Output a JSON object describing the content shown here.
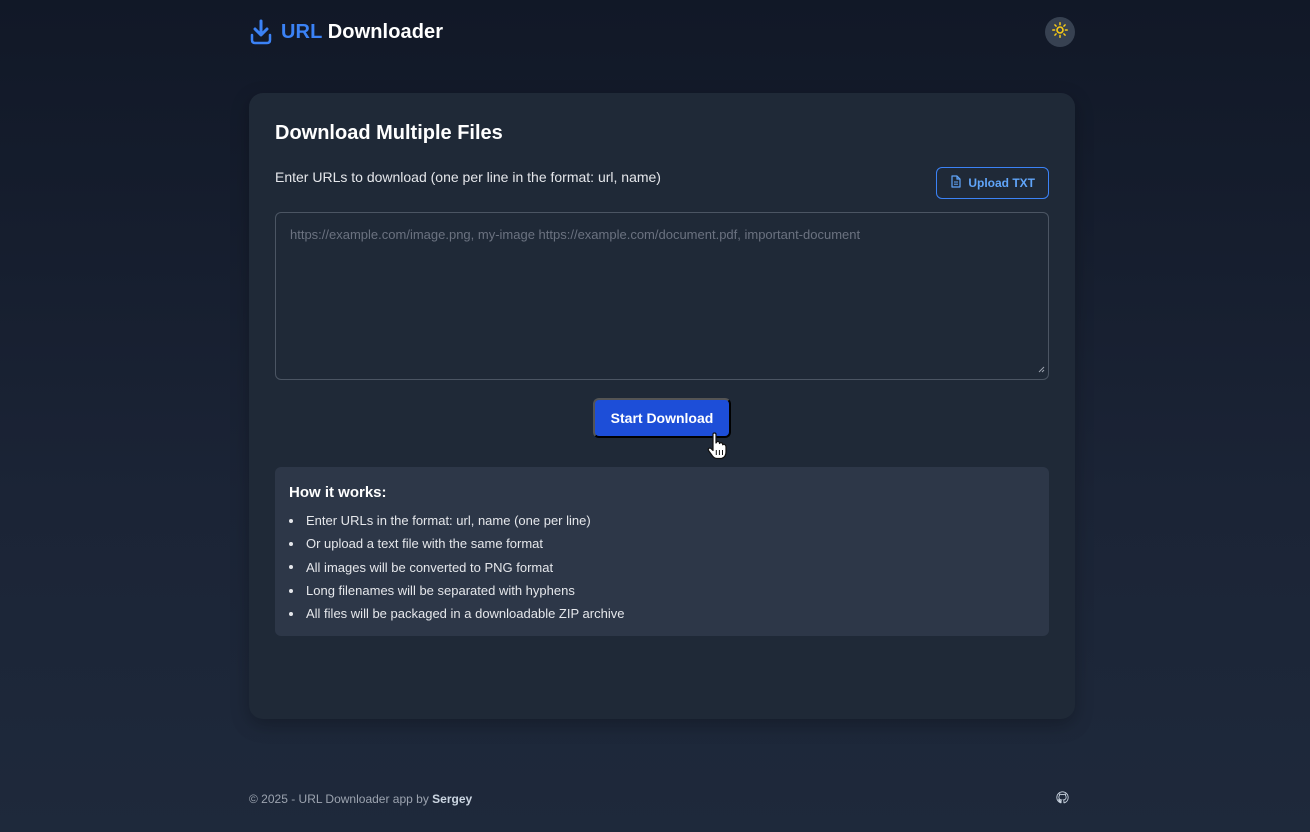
{
  "header": {
    "title_accent": "URL",
    "title_rest": " Downloader",
    "logo_icon": "download-icon",
    "theme_icon": "sun-icon"
  },
  "card": {
    "title": "Download Multiple Files",
    "instructions": "Enter URLs to download (one per line in the format: url, name)",
    "upload_label": "Upload TXT",
    "upload_icon": "file-icon",
    "textarea_placeholder": "https://example.com/image.png, my-image https://example.com/document.pdf, important-document",
    "start_label": "Start Download"
  },
  "howto": {
    "title": "How it works:",
    "items": [
      "Enter URLs in the format: url, name (one per line)",
      "Or upload a text file with the same format",
      "All images will be converted to PNG format",
      "Long filenames will be separated with hyphens",
      "All files will be packaged in a downloadable ZIP archive"
    ]
  },
  "footer": {
    "copyright": "© 2025 - URL Downloader app by ",
    "author": "Sergey",
    "github_icon": "github-icon"
  },
  "colors": {
    "accent": "#3b82f6",
    "button": "#1d4ed8",
    "card": "#1f2937",
    "sun": "#facc15"
  }
}
